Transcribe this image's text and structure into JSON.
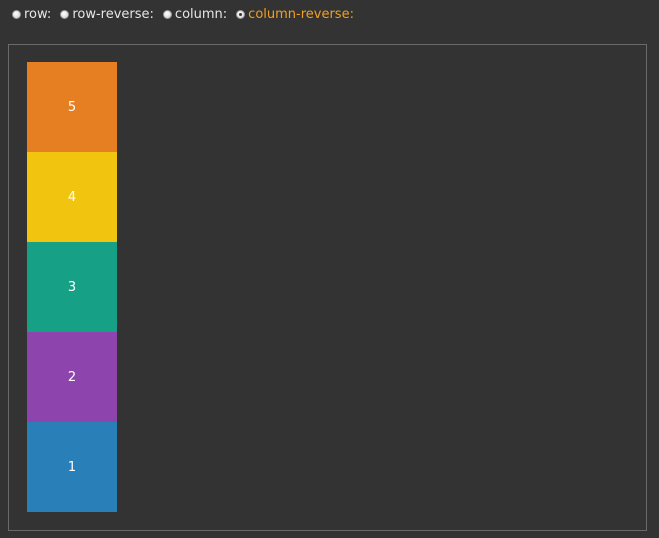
{
  "options": [
    {
      "id": "row",
      "label": "row:",
      "checked": false
    },
    {
      "id": "row-reverse",
      "label": "row-reverse:",
      "checked": false
    },
    {
      "id": "column",
      "label": "column:",
      "checked": false
    },
    {
      "id": "column-reverse",
      "label": "column-reverse:",
      "checked": true
    }
  ],
  "selected_direction": "column-reverse",
  "colors": {
    "active_label": "#f0a020",
    "background": "#333333",
    "border": "#6a6a6a"
  },
  "items": [
    {
      "label": "1",
      "color": "#2980b9"
    },
    {
      "label": "2",
      "color": "#8e44ad"
    },
    {
      "label": "3",
      "color": "#16a085"
    },
    {
      "label": "4",
      "color": "#f1c40f"
    },
    {
      "label": "5",
      "color": "#e67e22"
    }
  ]
}
